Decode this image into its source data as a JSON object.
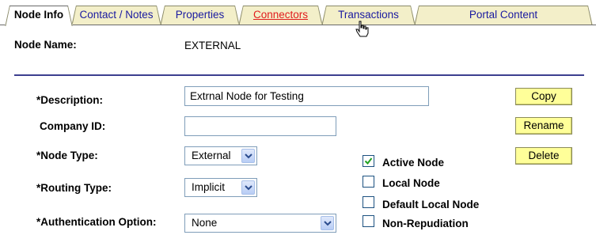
{
  "tabs": [
    {
      "label": "Node Info",
      "active": true
    },
    {
      "label": "Contact / Notes",
      "active": false
    },
    {
      "label": "Properties",
      "active": false
    },
    {
      "label": "Connectors",
      "active": false,
      "hover": true
    },
    {
      "label": "Transactions",
      "active": false
    },
    {
      "label": "Portal Content",
      "active": false
    }
  ],
  "node": {
    "name_label": "Node Name:",
    "name_value": "EXTERNAL"
  },
  "form": {
    "description_label": "*Description:",
    "description_value": "Extrnal Node for Testing",
    "company_id_label": "Company ID:",
    "company_id_value": "",
    "node_type_label": "*Node Type:",
    "node_type_value": "External",
    "routing_type_label": "*Routing Type:",
    "routing_type_value": "Implicit",
    "auth_option_label": "*Authentication Option:",
    "auth_option_value": "None"
  },
  "buttons": {
    "copy": "Copy",
    "rename": "Rename",
    "delete": "Delete"
  },
  "checkboxes": [
    {
      "label": "Active Node",
      "checked": true
    },
    {
      "label": "Local Node",
      "checked": false
    },
    {
      "label": "Default Local Node",
      "checked": false
    },
    {
      "label": "Non-Repudiation",
      "checked": false
    }
  ],
  "colors": {
    "divider": "#3d3f8f",
    "button_bg": "#ffff99",
    "tab_bg": "#f3efc9",
    "tab_link": "#1a1aa0",
    "tab_hover": "#e11b1b"
  }
}
